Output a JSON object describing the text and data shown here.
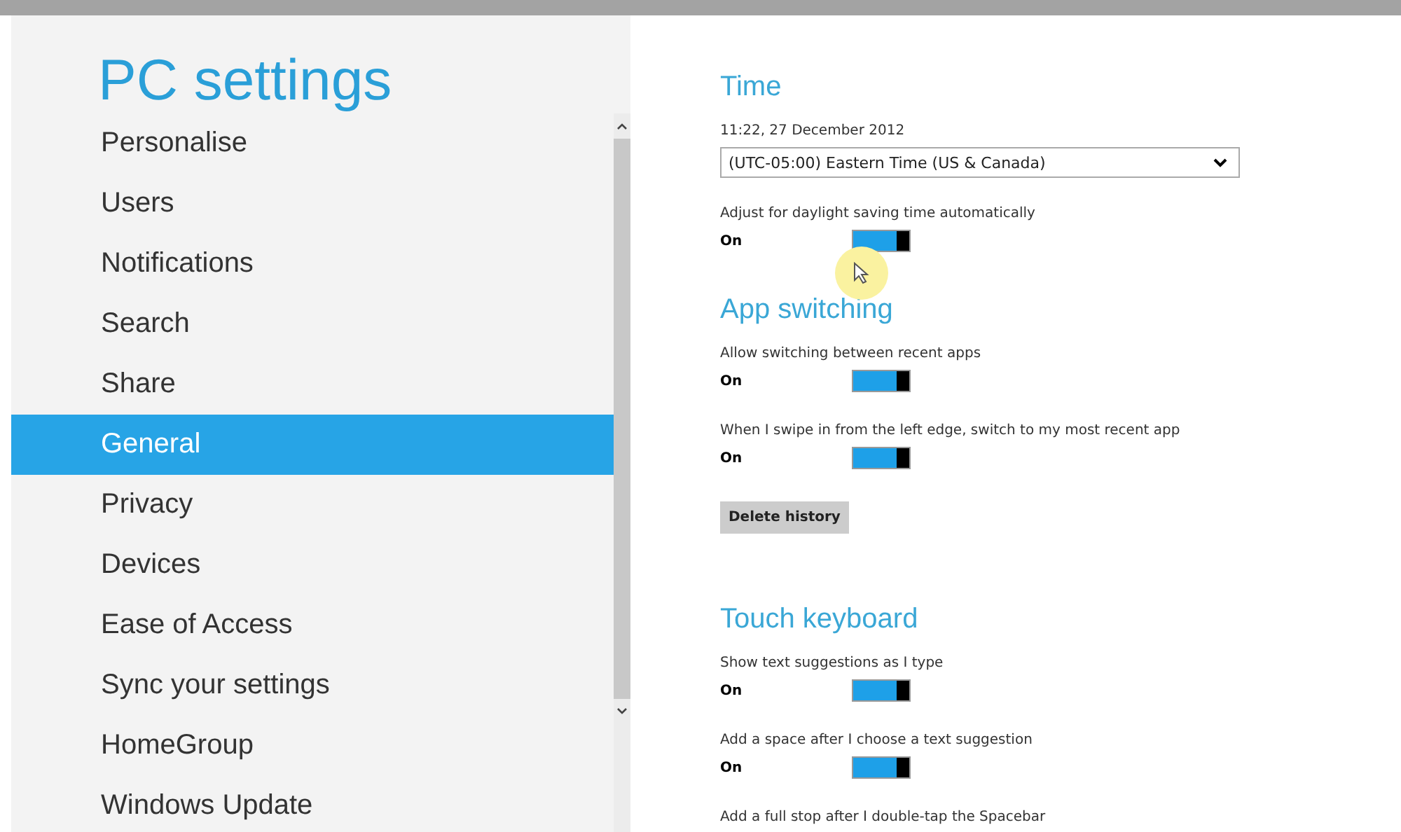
{
  "title": "PC settings",
  "sidebar": {
    "items": [
      {
        "label": "Personalise",
        "selected": false
      },
      {
        "label": "Users",
        "selected": false
      },
      {
        "label": "Notifications",
        "selected": false
      },
      {
        "label": "Search",
        "selected": false
      },
      {
        "label": "Share",
        "selected": false
      },
      {
        "label": "General",
        "selected": true
      },
      {
        "label": "Privacy",
        "selected": false
      },
      {
        "label": "Devices",
        "selected": false
      },
      {
        "label": "Ease of Access",
        "selected": false
      },
      {
        "label": "Sync your settings",
        "selected": false
      },
      {
        "label": "HomeGroup",
        "selected": false
      },
      {
        "label": "Windows Update",
        "selected": false
      }
    ]
  },
  "sections": [
    {
      "heading": "Time",
      "items": [
        {
          "kind": "text",
          "text": "11:22, 27 December 2012"
        },
        {
          "kind": "dropdown",
          "value": "(UTC-05:00) Eastern Time (US & Canada)"
        },
        {
          "kind": "toggle",
          "label": "Adjust for daylight saving time automatically",
          "state": "On",
          "on": true
        }
      ]
    },
    {
      "heading": "App switching",
      "items": [
        {
          "kind": "toggle",
          "label": "Allow switching between recent apps",
          "state": "On",
          "on": true
        },
        {
          "kind": "toggle",
          "label": "When I swipe in from the left edge, switch to my most recent app",
          "state": "On",
          "on": true
        },
        {
          "kind": "button",
          "label": "Delete history"
        }
      ]
    },
    {
      "heading": "Touch keyboard",
      "items": [
        {
          "kind": "toggle",
          "label": "Show text suggestions as I type",
          "state": "On",
          "on": true
        },
        {
          "kind": "toggle",
          "label": "Add a space after I choose a text suggestion",
          "state": "On",
          "on": true
        },
        {
          "kind": "text",
          "text": "Add a full stop after I double-tap the Spacebar"
        }
      ]
    }
  ]
}
